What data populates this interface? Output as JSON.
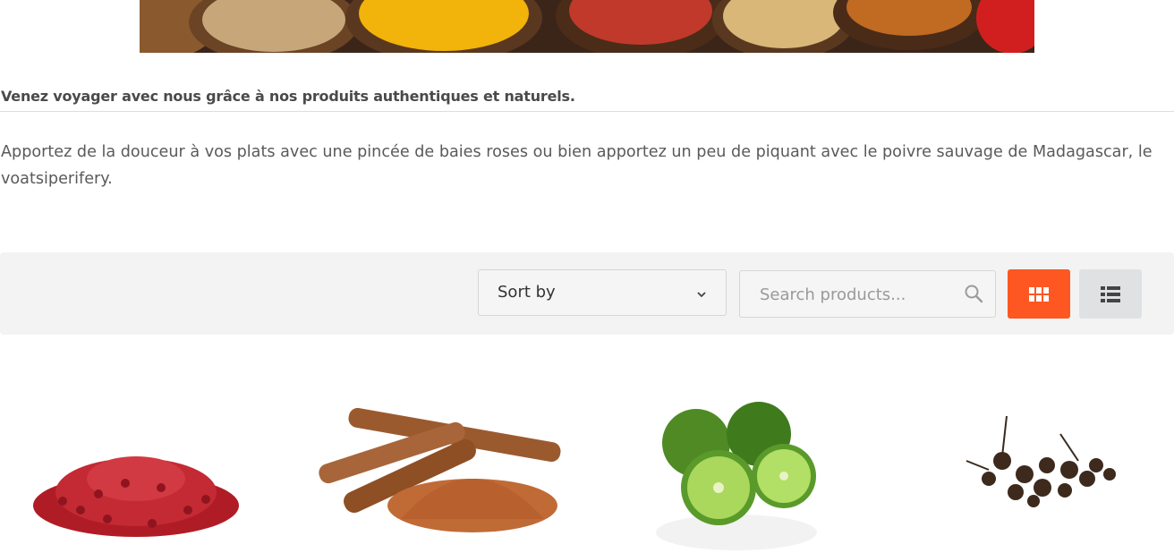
{
  "banner": {
    "alt": ""
  },
  "tagline": "Venez voyager avec nous grâce à nos produits authentiques et naturels.",
  "intro": "Apportez de la douceur à vos plats avec une pincée de baies roses ou bien apportez un peu de piquant avec le poivre sauvage de Madagascar, le voatsiperifery.",
  "toolbar": {
    "sort_label": "Sort by",
    "search_placeholder": "Search products...",
    "active_view": "grid",
    "accent_color": "#fe5722"
  },
  "products": [
    {
      "image": "pink-peppercorns"
    },
    {
      "image": "cinnamon-sticks-and-powder"
    },
    {
      "image": "kaffir-lime"
    },
    {
      "image": "wild-pepper"
    }
  ]
}
